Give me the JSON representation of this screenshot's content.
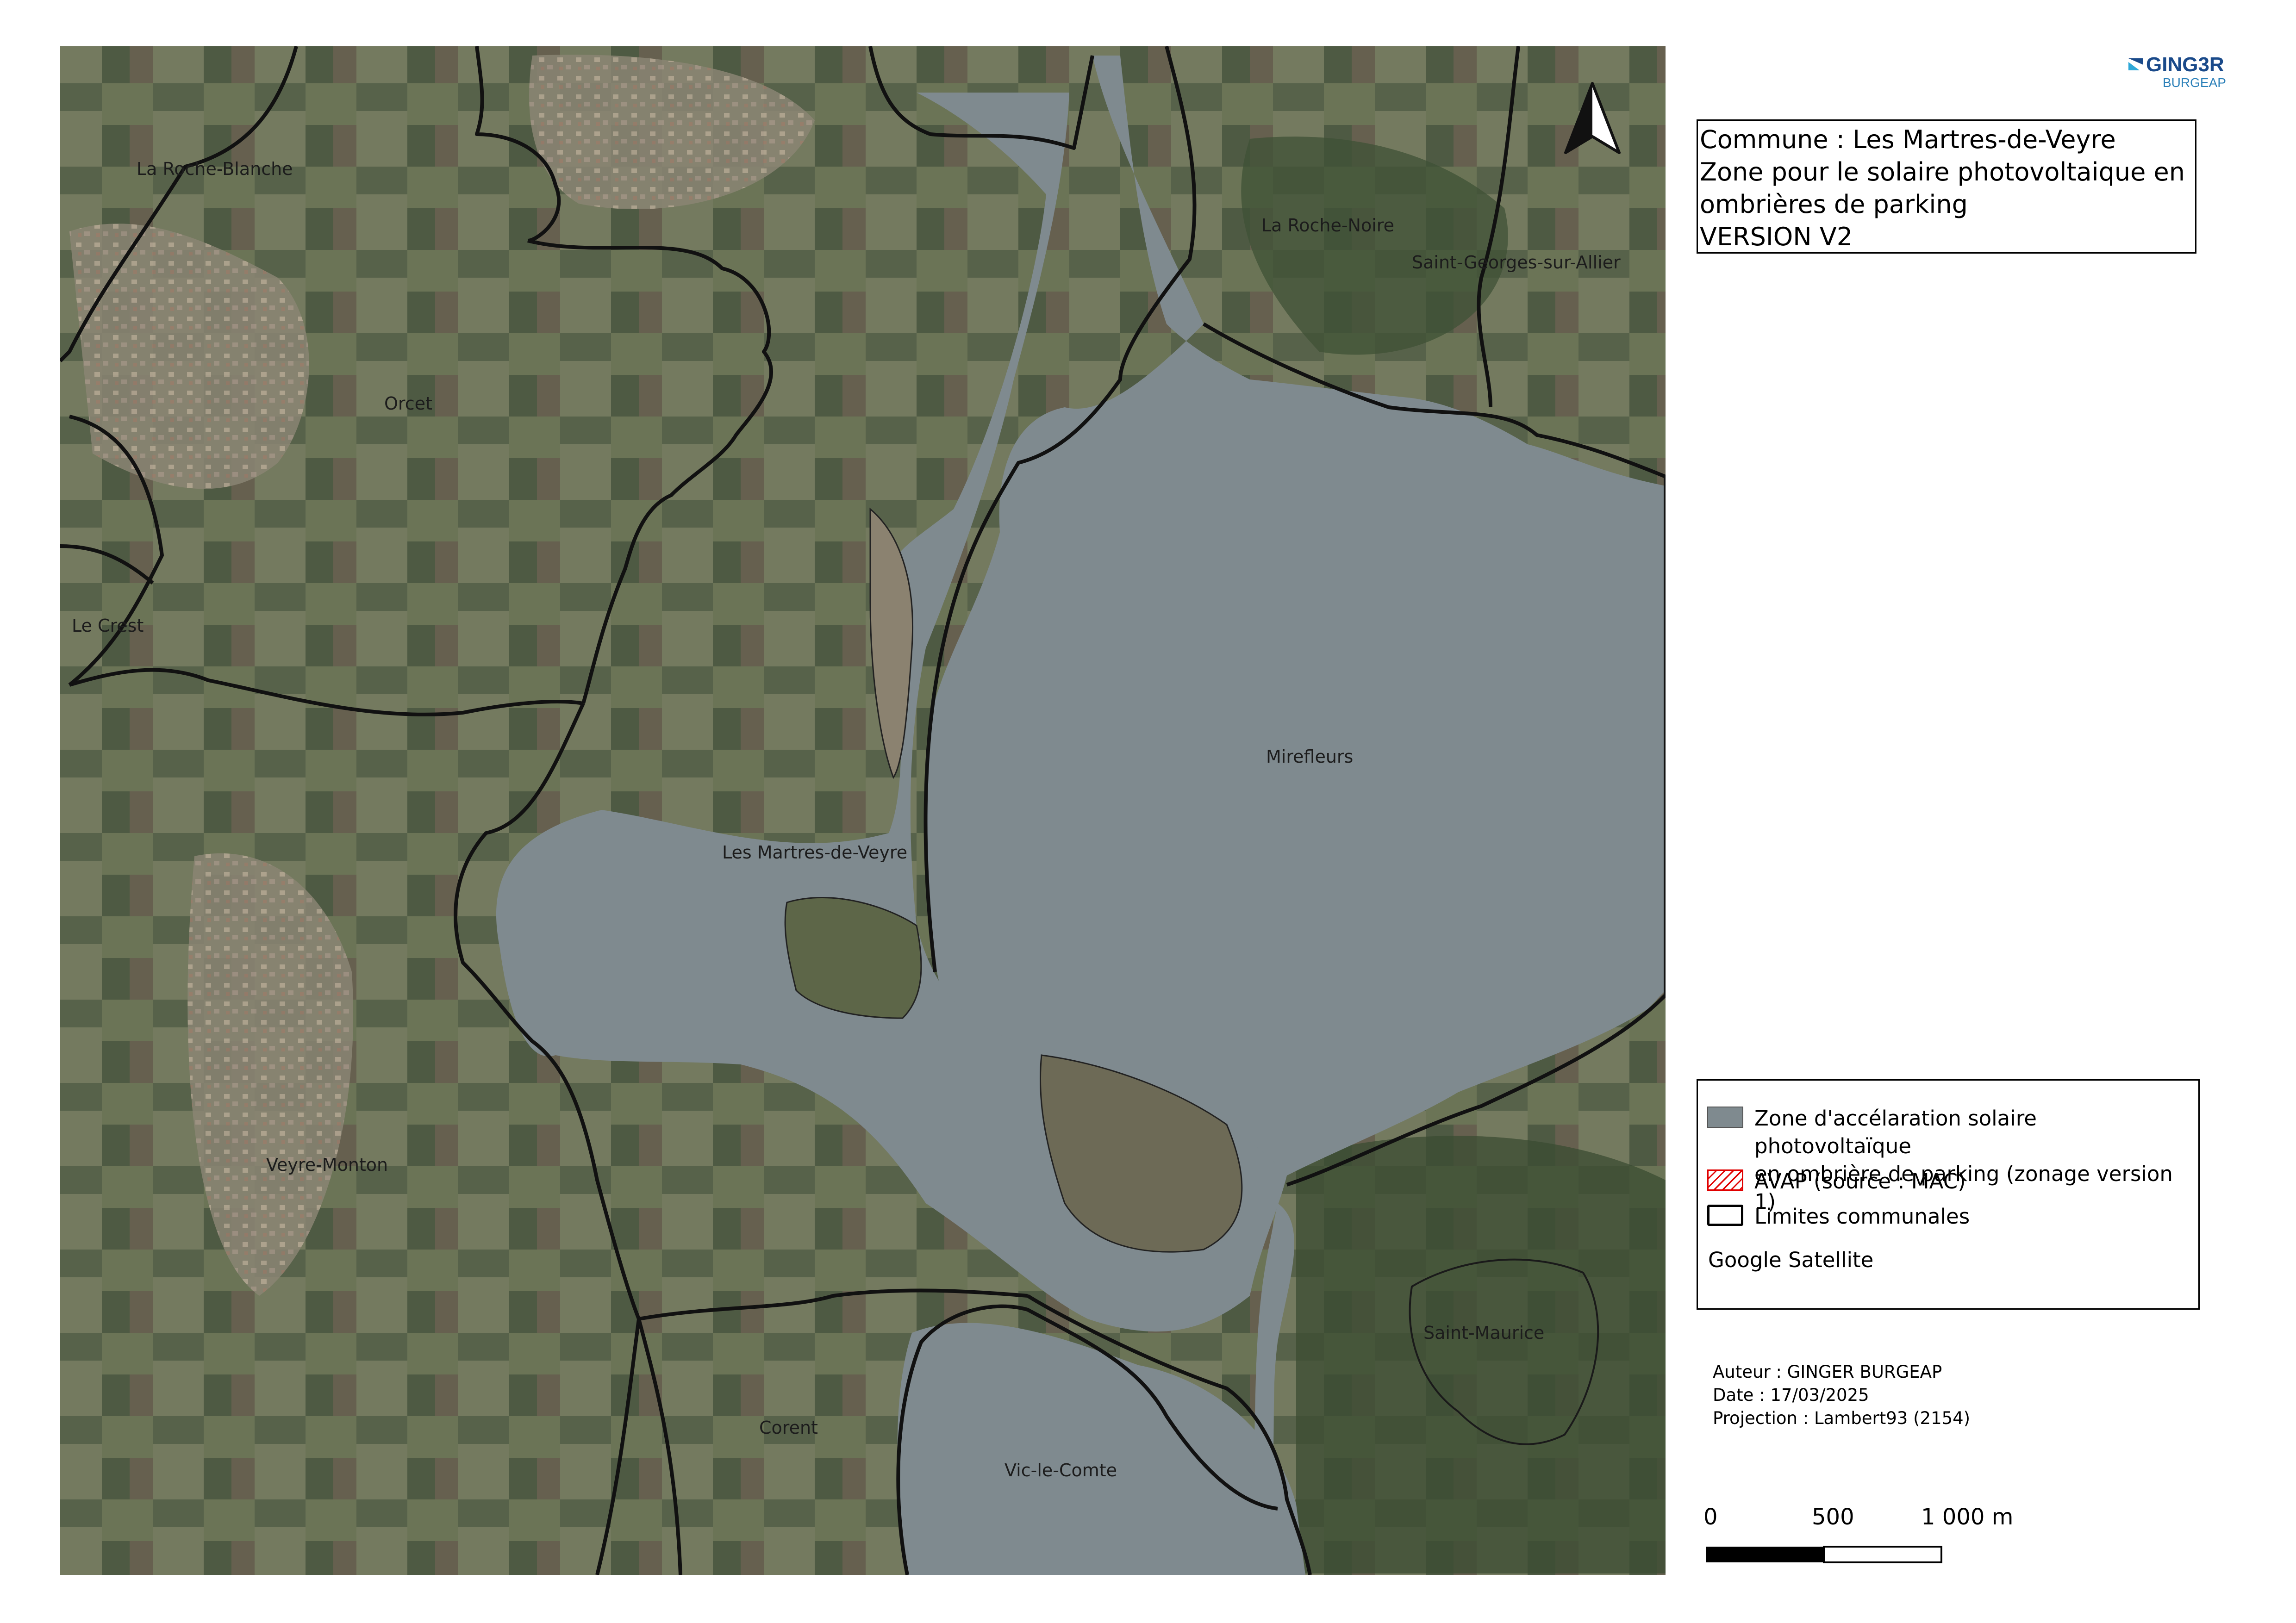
{
  "title": {
    "lines": [
      "Commune :  Les Martres-de-Veyre",
      "Zone pour le solaire photovoltaique en",
      "ombrières de parking",
      "VERSION V2"
    ]
  },
  "logo": {
    "line1": "GING3R",
    "line2": "BURGEAP",
    "icon": "ginger-logo-mark"
  },
  "north_arrow": {
    "icon": "north-arrow-icon"
  },
  "map": {
    "basemap": "satellite",
    "colors": {
      "zone_fill": "#7f8a8f",
      "commune_border": "#111111",
      "avap_hatch": "#e00000"
    },
    "places": [
      "La Roche-Blanche",
      "La Roche-Noire",
      "Saint-Georges-sur-Allier",
      "Orcet",
      "Le Crest",
      "Mirefleurs",
      "Les Martres-de-Veyre",
      "Veyre-Monton",
      "Saint-Maurice",
      "Corent",
      "Vic-le-Comte"
    ]
  },
  "legend": {
    "items": [
      {
        "label_lines": [
          "Zone d'accélaration solaire photovoltaïque",
          "en ombrière de parking (zonage version 1)"
        ],
        "swatch": "zone-fill",
        "color": "#7f8a8f"
      },
      {
        "label_lines": [
          "AVAP (source : MAC)"
        ],
        "swatch": "hatch",
        "color": "#e00000"
      },
      {
        "label_lines": [
          "Limites communales"
        ],
        "swatch": "outline",
        "color": "#000000"
      }
    ],
    "basemap_label": "Google Satellite"
  },
  "credits": {
    "author": "Auteur : GINGER BURGEAP",
    "date": "Date : 17/03/2025",
    "projection": "Projection : Lambert93 (2154)"
  },
  "scale": {
    "labels": [
      "0",
      "500",
      "1 000 m"
    ]
  }
}
